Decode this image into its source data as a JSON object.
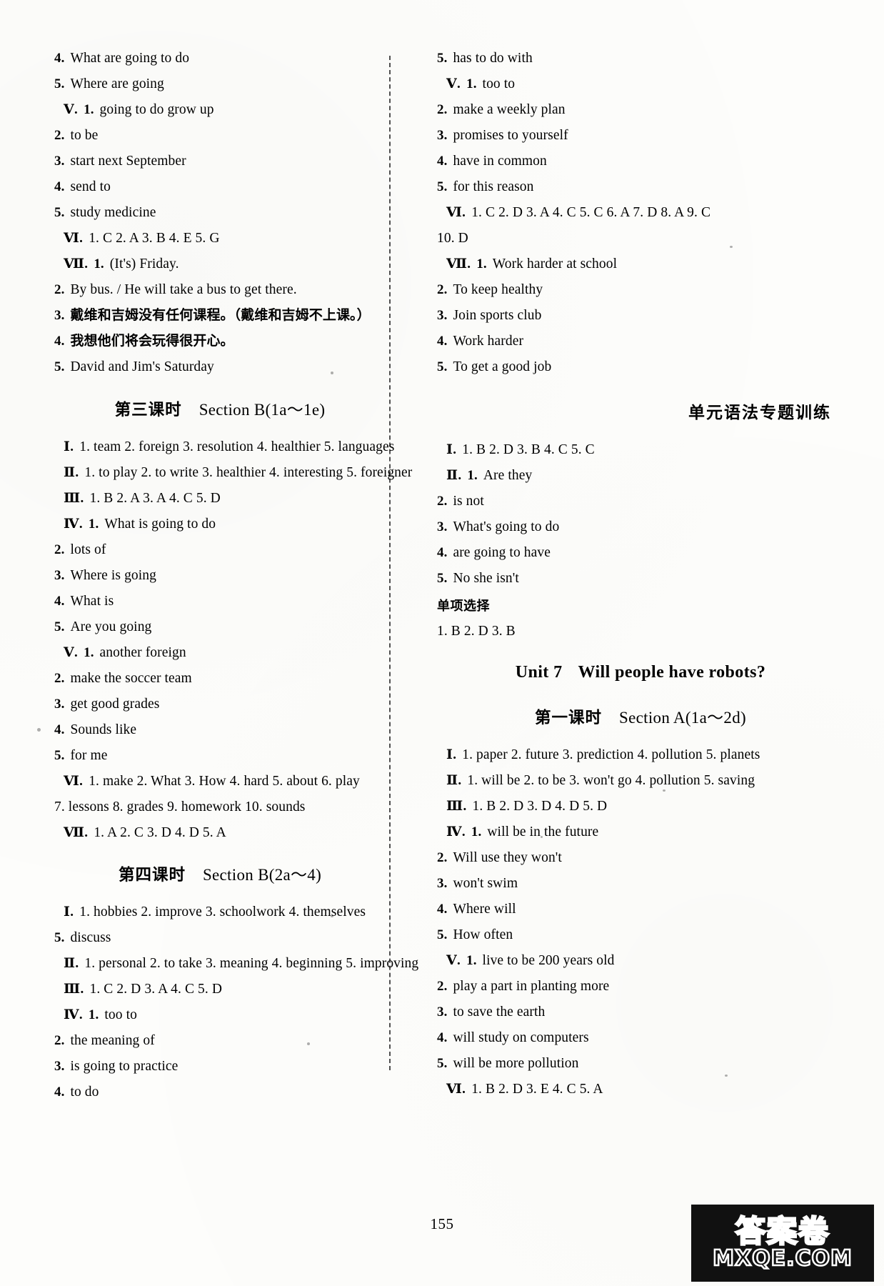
{
  "page": {
    "number": "155"
  },
  "divider": {
    "style": "dashed-vertical"
  },
  "left_column": {
    "top_block": {
      "lines": [
        {
          "num": "4.",
          "text": "What   are   going   to   do"
        },
        {
          "num": "5.",
          "text": "Where   are   going"
        },
        {
          "rn": "Ⅴ.",
          "num": "1.",
          "text": "going   to   do   grow   up"
        },
        {
          "num": "2.",
          "text": "to   be"
        },
        {
          "num": "3.",
          "text": "start   next   September"
        },
        {
          "num": "4.",
          "text": "send   to"
        },
        {
          "num": "5.",
          "text": "study   medicine"
        },
        {
          "rn": "Ⅵ.",
          "text": "1. C   2. A   3. B   4. E   5. G"
        },
        {
          "rn": "Ⅶ.",
          "num": "1.",
          "text": "(It's) Friday."
        },
        {
          "num": "2.",
          "text": "By bus. / He will take a bus to get there."
        },
        {
          "num": "3.",
          "text": "戴维和吉姆没有任何课程。（戴维和吉姆不上课。）",
          "lang": "zh"
        },
        {
          "num": "4.",
          "text": "我想他们将会玩得很开心。",
          "lang": "zh"
        },
        {
          "num": "5.",
          "text": "David and Jim's Saturday"
        }
      ]
    },
    "section_3": {
      "heading_zh": "第三课时",
      "heading_en": "Section B(1a～1e)",
      "lines": [
        {
          "rn": "Ⅰ.",
          "text": "1. team   2. foreign   3. resolution   4. healthier   5. languages"
        },
        {
          "rn": "Ⅱ.",
          "text": "1. to play   2. to write   3. healthier   4. interesting   5. foreigner"
        },
        {
          "rn": "Ⅲ.",
          "text": "1. B   2. A   3. A   4. C   5. D"
        },
        {
          "rn": "Ⅳ.",
          "num": "1.",
          "text": "What   is   going   to   do"
        },
        {
          "num": "2.",
          "text": "lots   of"
        },
        {
          "num": "3.",
          "text": "Where   is   going"
        },
        {
          "num": "4.",
          "text": "What   is"
        },
        {
          "num": "5.",
          "text": "Are   you   going"
        },
        {
          "rn": "Ⅴ.",
          "num": "1.",
          "text": "another   foreign"
        },
        {
          "num": "2.",
          "text": "make   the   soccer   team"
        },
        {
          "num": "3.",
          "text": "get   good   grades"
        },
        {
          "num": "4.",
          "text": "Sounds   like"
        },
        {
          "num": "5.",
          "text": "for   me"
        },
        {
          "rn": "Ⅵ.",
          "text": "1. make   2. What   3. How   4. hard   5. about   6. play"
        },
        {
          "text": "7. lessons   8. grades   9. homework   10. sounds"
        },
        {
          "rn": "Ⅶ.",
          "text": "1. A   2. C   3. D   4. D   5. A"
        }
      ]
    },
    "section_4": {
      "heading_zh": "第四课时",
      "heading_en": "Section B(2a～4)",
      "lines": [
        {
          "rn": "Ⅰ.",
          "text": "1. hobbies   2. improve   3. schoolwork   4. themselves"
        },
        {
          "num": "5.",
          "text": "discuss"
        },
        {
          "rn": "Ⅱ.",
          "text": "1. personal   2. to take   3. meaning   4. beginning   5. improving"
        },
        {
          "rn": "Ⅲ.",
          "text": "1. C   2. D   3. A   4. C   5. D"
        },
        {
          "rn": "Ⅳ.",
          "num": "1.",
          "text": "too   to"
        },
        {
          "num": "2.",
          "text": "the   meaning   of"
        },
        {
          "num": "3.",
          "text": "is   going   to   practice"
        },
        {
          "num": "4.",
          "text": "to   do"
        }
      ]
    }
  },
  "right_column": {
    "top_block": {
      "lines": [
        {
          "num": "5.",
          "text": "has   to   do   with"
        },
        {
          "rn": "Ⅴ.",
          "num": "1.",
          "text": "too   to"
        },
        {
          "num": "2.",
          "text": "make   a   weekly   plan"
        },
        {
          "num": "3.",
          "text": "promises   to   yourself"
        },
        {
          "num": "4.",
          "text": "have   in   common"
        },
        {
          "num": "5.",
          "text": "for   this   reason"
        },
        {
          "rn": "Ⅵ.",
          "text": "1. C   2. D   3. A   4. C   5. C   6. A   7. D   8. A   9. C"
        },
        {
          "text": "10. D"
        },
        {
          "rn": "Ⅶ.",
          "num": "1.",
          "text": "Work harder at school"
        },
        {
          "num": "2.",
          "text": "To keep healthy"
        },
        {
          "num": "3.",
          "text": "Join sports club"
        },
        {
          "num": "4.",
          "text": "Work harder"
        },
        {
          "num": "5.",
          "text": "To get a good job"
        }
      ]
    },
    "grammar_section": {
      "heading_zh": "单元语法专题训练",
      "lines": [
        {
          "rn": "Ⅰ.",
          "text": "1. B   2. D   3. B   4. C   5. C"
        },
        {
          "rn": "Ⅱ.",
          "num": "1.",
          "text": "Are   they"
        },
        {
          "num": "2.",
          "text": "is   not"
        },
        {
          "num": "3.",
          "text": "What's   going   to   do"
        },
        {
          "num": "4.",
          "text": "are   going   to   have"
        },
        {
          "num": "5.",
          "text": "No   she   isn't"
        }
      ],
      "sub_heading": "单项选择",
      "sub_lines": [
        {
          "text": "1. B   2. D   3. B"
        }
      ]
    },
    "unit_7": {
      "unit_label": "Unit 7",
      "unit_title": "Will people have robots?",
      "section_heading_zh": "第一课时",
      "section_heading_en": "Section A(1a～2d)",
      "lines": [
        {
          "rn": "Ⅰ.",
          "text": "1. paper   2. future   3. prediction   4. pollution   5. planets"
        },
        {
          "rn": "Ⅱ.",
          "text": "1. will be   2. to be   3. won't go   4. pollution   5. saving"
        },
        {
          "rn": "Ⅲ.",
          "text": "1. B   2. D   3. D   4. D   5. D"
        },
        {
          "rn": "Ⅳ.",
          "num": "1.",
          "text": "will   be   in   the   future"
        },
        {
          "num": "2.",
          "text": "Will   use   they   won't"
        },
        {
          "num": "3.",
          "text": "won't   swim"
        },
        {
          "num": "4.",
          "text": "Where   will"
        },
        {
          "num": "5.",
          "text": "How   often"
        },
        {
          "rn": "Ⅴ.",
          "num": "1.",
          "text": "live   to   be   200   years   old"
        },
        {
          "num": "2.",
          "text": "play   a   part   in   planting   more"
        },
        {
          "num": "3.",
          "text": "to   save   the   earth"
        },
        {
          "num": "4.",
          "text": "will   study   on   computers"
        },
        {
          "num": "5.",
          "text": "will   be   more   pollution"
        },
        {
          "rn": "Ⅵ.",
          "text": "1. B   2. D   3. E   4. C   5. A"
        }
      ]
    }
  },
  "watermark": {
    "chinese": "答案卷",
    "url": "MXQE.COM"
  }
}
